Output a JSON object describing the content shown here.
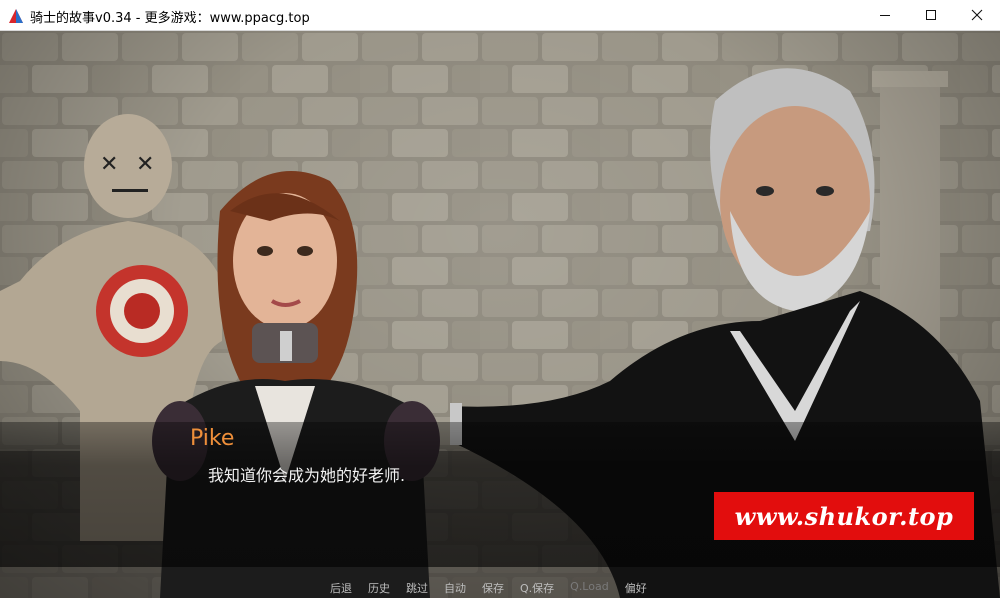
{
  "window": {
    "title": "骑士的故事v0.34 - 更多游戏：www.ppacg.top",
    "icon": "renpy-triangle-icon",
    "controls": [
      "minimize-icon",
      "maximize-icon",
      "close-icon"
    ]
  },
  "dialogue": {
    "speaker": "Pike",
    "text": "我知道你会成为她的好老师."
  },
  "watermark": {
    "text": "www.shukor.top",
    "color": "#e20d0d"
  },
  "quick_menu": {
    "items": [
      {
        "label": "后退"
      },
      {
        "label": "历史"
      },
      {
        "label": "跳过"
      },
      {
        "label": "自动"
      },
      {
        "label": "保存"
      },
      {
        "label": "Q.保存"
      },
      {
        "label": "Q.Load"
      },
      {
        "label": "偏好"
      }
    ]
  },
  "colors": {
    "speaker": "#ee8f3a",
    "dialogue": "#f2f2f2",
    "quick_menu": "#bdbdbd"
  }
}
